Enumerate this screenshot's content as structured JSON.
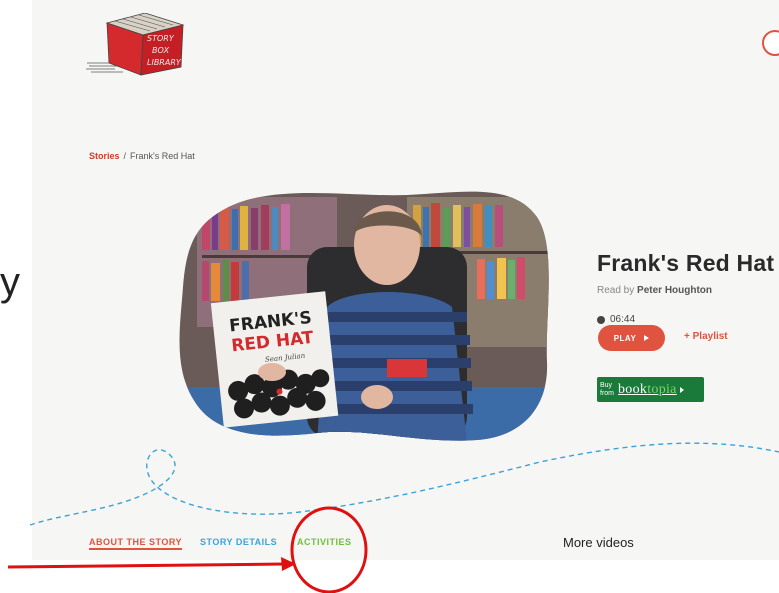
{
  "header": {
    "logo_text": [
      "STORY",
      "BOX",
      "LIBRARY"
    ],
    "icon": "circle-outline-icon"
  },
  "side_partial_char": "y",
  "breadcrumb": {
    "root": "Stories",
    "separator": "/",
    "current": "Frank's Red Hat"
  },
  "hero": {
    "book_title_line1": "FRANK'S",
    "book_title_line2": "RED HAT",
    "book_author_script": "Sean Julian"
  },
  "story": {
    "title": "Frank's Red Hat",
    "reader_prefix": "Read by",
    "reader_name": "Peter Houghton",
    "duration": "06:44",
    "play_label": "PLAY",
    "playlist_label": "+ Playlist",
    "buy_line1": "Buy",
    "buy_line2": "from",
    "booktopia_a": "book",
    "booktopia_b": "topia"
  },
  "tabs": [
    {
      "label": "ABOUT THE STORY",
      "active": true
    },
    {
      "label": "STORY DETAILS",
      "active": false
    },
    {
      "label": "ACTIVITIES",
      "active": false
    }
  ],
  "more_videos": "More videos",
  "colors": {
    "accent": "#e0533f",
    "details": "#3aa3d9",
    "activities": "#6fbf3c",
    "annotation": "#e01010",
    "booktopia": "#1a7a3a"
  }
}
